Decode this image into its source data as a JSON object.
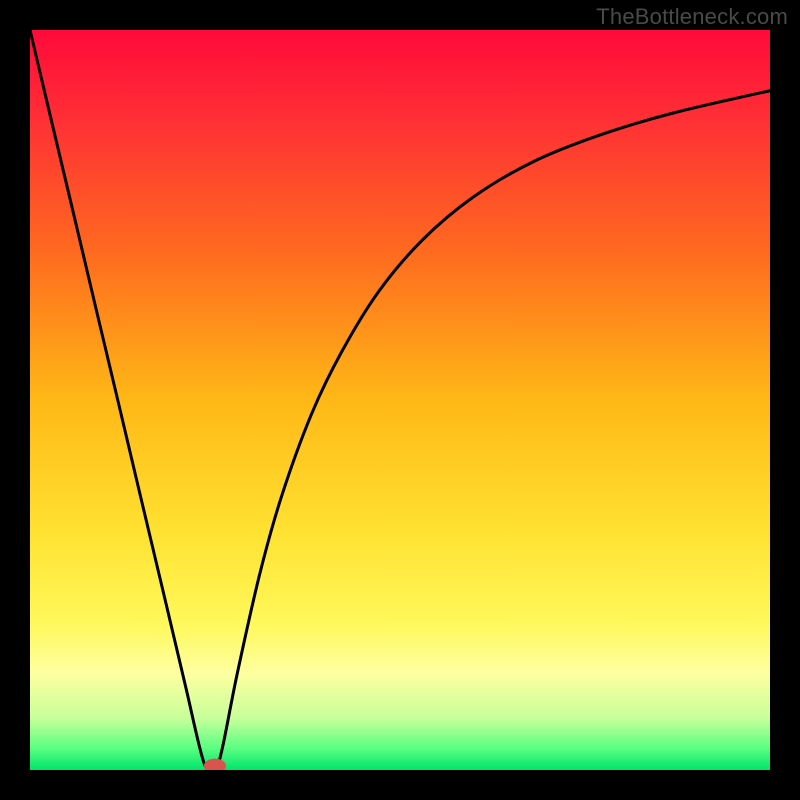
{
  "watermark": "TheBottleneck.com",
  "chart_data": {
    "type": "line",
    "title": "",
    "xlabel": "",
    "ylabel": "",
    "xlim": [
      0,
      1
    ],
    "ylim": [
      0,
      1
    ],
    "gradient_stops": [
      {
        "offset": 0.0,
        "color": "#ff0a3a"
      },
      {
        "offset": 0.12,
        "color": "#ff2f35"
      },
      {
        "offset": 0.3,
        "color": "#ff6a1f"
      },
      {
        "offset": 0.5,
        "color": "#ffb816"
      },
      {
        "offset": 0.68,
        "color": "#ffe232"
      },
      {
        "offset": 0.8,
        "color": "#fff85a"
      },
      {
        "offset": 0.87,
        "color": "#feffa0"
      },
      {
        "offset": 0.93,
        "color": "#c7ff9a"
      },
      {
        "offset": 0.97,
        "color": "#5cff82"
      },
      {
        "offset": 1.0,
        "color": "#00e46b"
      }
    ],
    "curve": {
      "x": [
        0.0,
        0.03,
        0.06,
        0.09,
        0.12,
        0.15,
        0.18,
        0.21,
        0.235,
        0.25,
        0.26,
        0.28,
        0.31,
        0.34,
        0.38,
        0.42,
        0.47,
        0.53,
        0.6,
        0.68,
        0.77,
        0.87,
        1.0
      ],
      "y": [
        1.0,
        0.873,
        0.747,
        0.62,
        0.494,
        0.367,
        0.241,
        0.114,
        0.01,
        0.0,
        0.03,
        0.13,
        0.263,
        0.37,
        0.48,
        0.563,
        0.645,
        0.716,
        0.775,
        0.822,
        0.858,
        0.888,
        0.918
      ]
    },
    "min_marker": {
      "x": 0.25,
      "y": 0.0,
      "rx": 0.015,
      "ry": 0.01,
      "color": "#d9534f"
    }
  }
}
